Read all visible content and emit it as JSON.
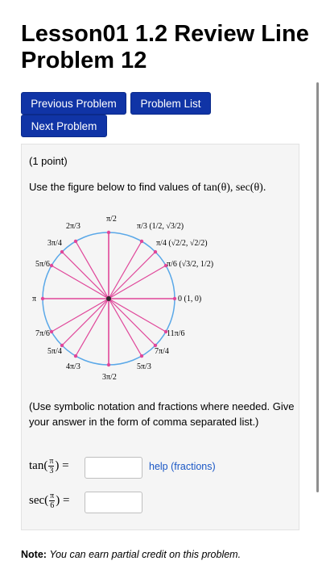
{
  "header": {
    "title_line1": "Lesson01 1.2 Review Line",
    "title_line2": "Problem 12"
  },
  "nav": {
    "previous_label": "Previous Problem",
    "list_label": "Problem List",
    "next_label": "Next Problem"
  },
  "problem": {
    "points": "(1 point)",
    "instruction_prefix": "Use the figure below to find values of ",
    "instruction_math": "tan(θ), sec(θ).",
    "hint": "(Use symbolic notation and fractions where needed. Give your answer in the form of comma separated list.)",
    "q1_func": "tan(",
    "q1_num": "π",
    "q1_den": "3",
    "q1_suffix": ") =",
    "q1_value": "",
    "help_label": "help (fractions)",
    "q2_func": "sec(",
    "q2_num": "π",
    "q2_den": "6",
    "q2_suffix": ") =",
    "q2_value": ""
  },
  "figure": {
    "colors": {
      "circle": "#5aa8e8",
      "spokes": "#e0479a",
      "axes": "#e0479a",
      "dot": "#2a2a2a"
    },
    "labels": {
      "pi_over_2": "π/2",
      "two_pi_over_3": "2π/3",
      "three_pi_over_4": "3π/4",
      "five_pi_over_6": "5π/6",
      "pi": "π",
      "seven_pi_over_6": "7π/6",
      "five_pi_over_4": "5π/4",
      "four_pi_over_3": "4π/3",
      "three_pi_over_2": "3π/2",
      "five_pi_over_3": "5π/3",
      "seven_pi_over_4": "7π/4",
      "eleven_pi_over_6": "11π/6",
      "zero_point": "0 (1, 0)",
      "pi_over_3_point": "π/3 (1/2, √3/2)",
      "pi_over_4_point": "π/4 (√2/2, √2/2)",
      "pi_over_6_point": "π/6 (√3/2, 1/2)"
    }
  },
  "footer": {
    "note_label": "Note:",
    "note_text": "You can earn partial credit on this problem."
  }
}
